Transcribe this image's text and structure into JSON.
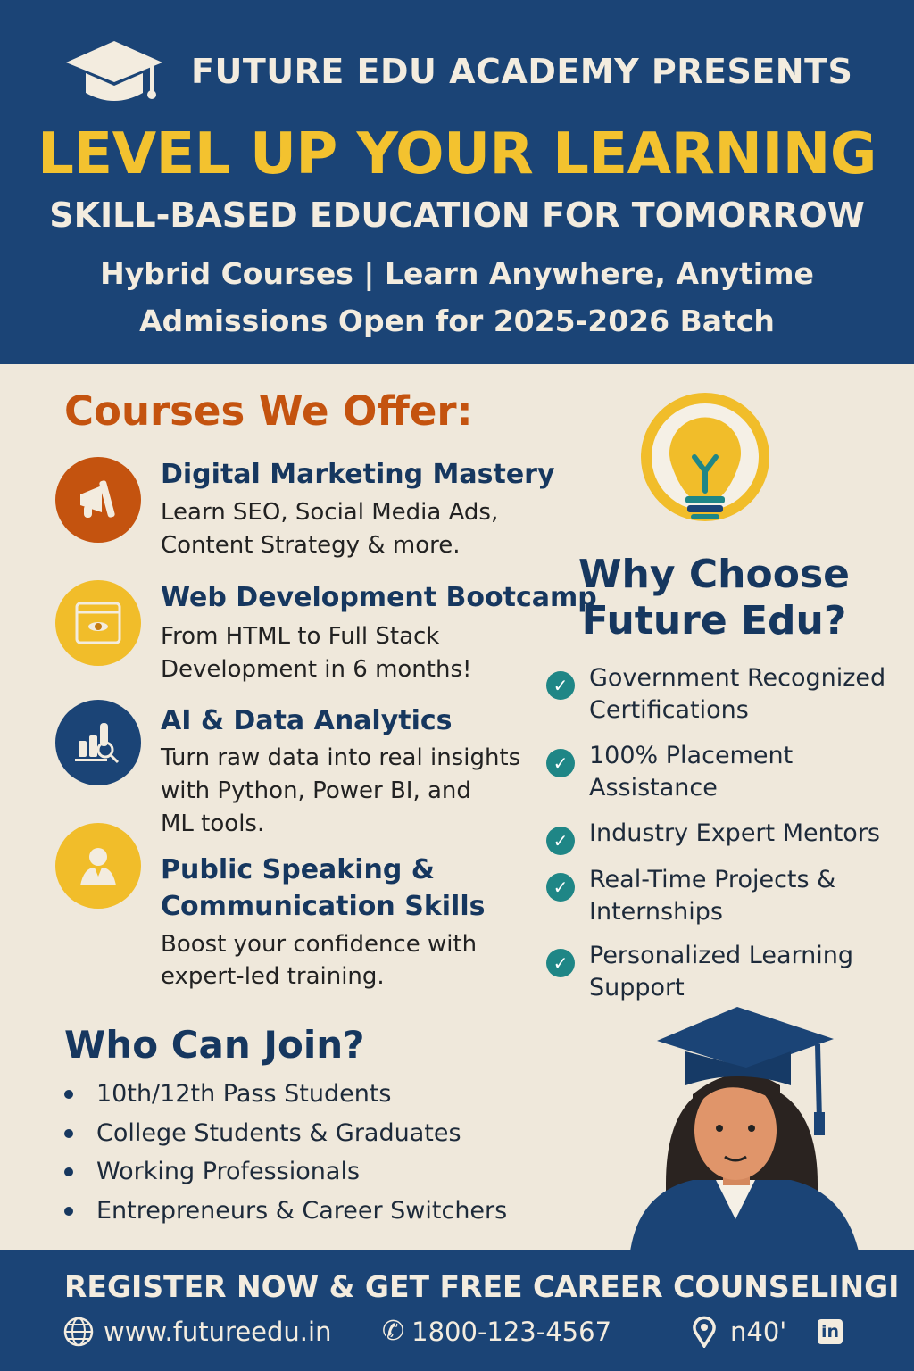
{
  "header": {
    "presents": "FUTURE EDU ACADEMY PRESENTS",
    "title": "LEVEL UP YOUR LEARNING",
    "subtitle": "SKILL-BASED EDUCATION FOR TOMORROW",
    "line1": "Hybrid Courses | Learn Anywhere, Anytime",
    "line2": "Admissions Open for 2025-2026 Batch"
  },
  "courses": {
    "heading": "Courses We Offer:",
    "items": [
      {
        "title": "Digital Marketing Mastery",
        "desc1": "Learn SEO, Social Media Ads,",
        "desc2": "Content Strategy & more.",
        "icon": "megaphone-icon",
        "color": "#c4530f"
      },
      {
        "title": "Web Development Bootcamp",
        "desc1": "From HTML to Full Stack",
        "desc2": "Development in 6 months!",
        "icon": "browser-window-icon",
        "color": "#f1bd2a"
      },
      {
        "title": "AI & Data Analytics",
        "desc1": "Turn raw data into real insights",
        "desc2": "with Python, Power BI, and",
        "desc3": "ML tools.",
        "icon": "chart-magnifier-icon",
        "color": "#1b4476"
      },
      {
        "title1": "Public Speaking &",
        "title2": "Communication Skills",
        "desc1": "Boost your confidence with",
        "desc2": "expert-led training.",
        "icon": "person-icon",
        "color": "#f1bd2a"
      }
    ]
  },
  "why": {
    "heading1": "Why Choose",
    "heading2": "Future Edu?",
    "items": [
      "Government Recognized Certifications",
      "100% Placement Assistance",
      "Industry Expert Mentors",
      "Real-Time Projects & Internships",
      "Personalized Learning Support"
    ]
  },
  "who": {
    "heading": "Who Can Join?",
    "items": [
      "10th/12th Pass Students",
      "College Students & Graduates",
      "Working Professionals",
      "Entrepreneurs & Career Switchers"
    ]
  },
  "footer": {
    "cta": "REGISTER NOW & GET FREE CAREER COUNSELINGI",
    "website": "www.futureedu.in",
    "phone": "1800-123-4567",
    "location": "n40'",
    "linkedin": "in"
  },
  "colors": {
    "navy": "#1b4476",
    "yellow": "#f3c22f",
    "orange": "#c4530f",
    "cream": "#efe8db",
    "teal": "#1f8686"
  }
}
